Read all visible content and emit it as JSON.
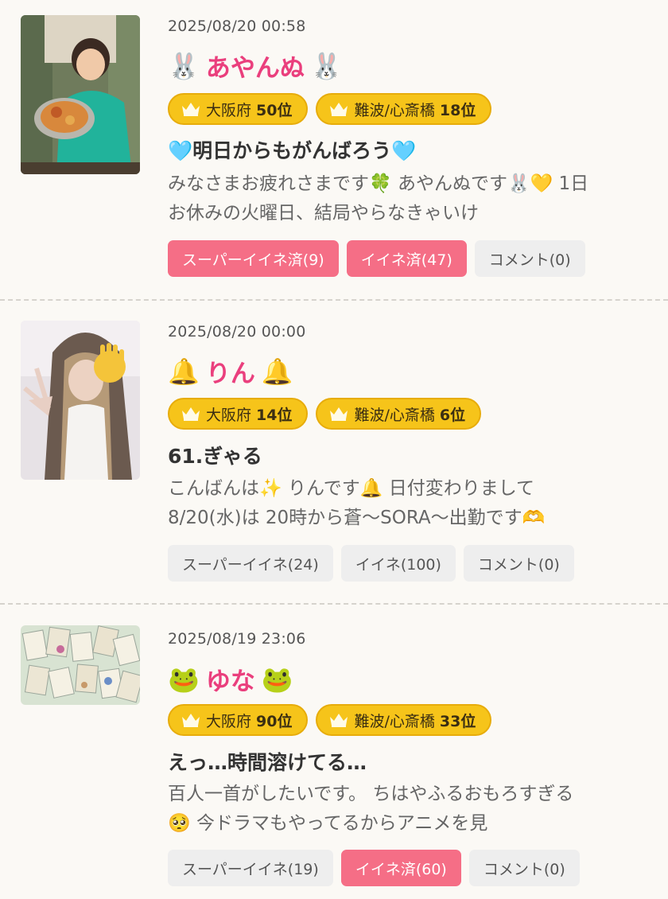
{
  "colors": {
    "accent_pink": "#ea3f7d",
    "liked_button": "#f56e86",
    "badge_gold": "#f6c41a",
    "background": "#fbf9f5"
  },
  "posts": [
    {
      "date": "2025/08/20 00:58",
      "name": "あやんぬ",
      "name_emoji_left": "🐰",
      "name_emoji_right": "🐰",
      "badges": [
        {
          "label": "大阪府",
          "rank": "50位"
        },
        {
          "label": "難波/心斎橋",
          "rank": "18位"
        }
      ],
      "title": "🩵明日からもがんばろう🩵",
      "body_lines": [
        "みなさまお疲れさまです🍀 あやんぬです🐰💛 1日",
        "お休みの火曜日、結局やらなきゃいけ"
      ],
      "buttons": [
        {
          "label": "スーパーイイネ済(9)",
          "state": "active"
        },
        {
          "label": "イイネ済(47)",
          "state": "active"
        },
        {
          "label": "コメント(0)",
          "state": "inactive"
        }
      ],
      "thumbnail": "photo of woman holding a plate of food"
    },
    {
      "date": "2025/08/20 00:00",
      "name": "りん",
      "name_emoji_left": "🔔",
      "name_emoji_right": "🔔",
      "badges": [
        {
          "label": "大阪府",
          "rank": "14位"
        },
        {
          "label": "難波/心斎橋",
          "rank": "6位"
        }
      ],
      "title": "61.ぎゃる",
      "body_lines": [
        "こんばんは✨ りんです🔔 日付変わりまして",
        "8/20(水)は 20時から蒼〜SORA〜出勤です🫶"
      ],
      "buttons": [
        {
          "label": "スーパーイイネ(24)",
          "state": "inactive"
        },
        {
          "label": "イイネ(100)",
          "state": "inactive"
        },
        {
          "label": "コメント(0)",
          "state": "inactive"
        }
      ],
      "thumbnail": "photo of woman with long hair waving"
    },
    {
      "date": "2025/08/19 23:06",
      "name": "ゆな",
      "name_emoji_left": "🐸",
      "name_emoji_right": "🐸",
      "badges": [
        {
          "label": "大阪府",
          "rank": "90位"
        },
        {
          "label": "難波/心斎橋",
          "rank": "33位"
        }
      ],
      "title": "えっ…時間溶けてる…",
      "body_lines": [
        "百人一首がしたいです。 ちはやふるおもろすぎる",
        "🥺 今ドラマもやってるからアニメを見"
      ],
      "buttons": [
        {
          "label": "スーパーイイネ(19)",
          "state": "inactive"
        },
        {
          "label": "イイネ済(60)",
          "state": "active"
        },
        {
          "label": "コメント(0)",
          "state": "inactive"
        }
      ],
      "thumbnail": "photo of karuta cards spread on a table"
    }
  ]
}
